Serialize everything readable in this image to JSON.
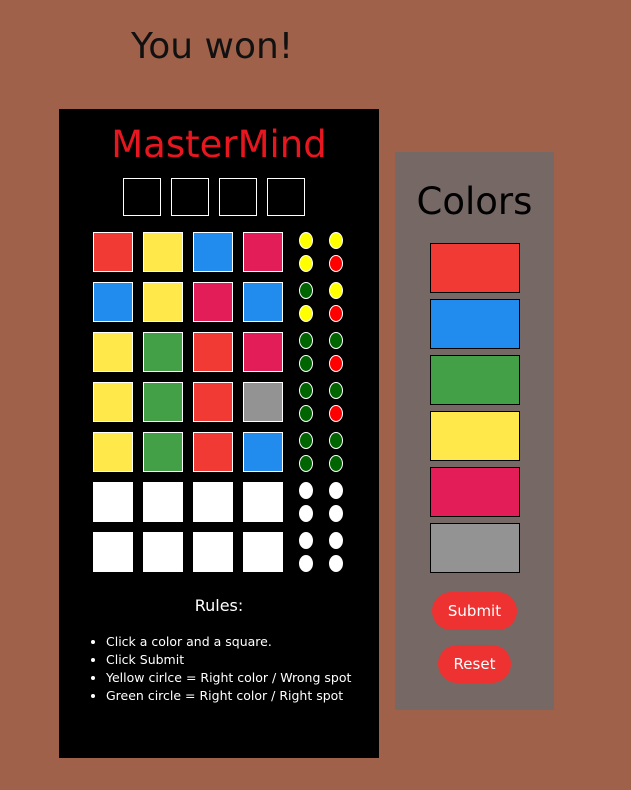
{
  "status_message": "You won!",
  "board": {
    "title": "MasterMind",
    "secret_slots": 4,
    "rows": [
      {
        "squares": [
          "red",
          "yellow",
          "blue",
          "pink"
        ],
        "pegs": [
          "yellow",
          "yellow",
          "yellow",
          "red"
        ]
      },
      {
        "squares": [
          "blue",
          "yellow",
          "pink",
          "blue"
        ],
        "pegs": [
          "green",
          "yellow",
          "yellow",
          "red"
        ]
      },
      {
        "squares": [
          "yellow",
          "green",
          "red",
          "pink"
        ],
        "pegs": [
          "green",
          "green",
          "green",
          "red"
        ]
      },
      {
        "squares": [
          "yellow",
          "green",
          "red",
          "gray"
        ],
        "pegs": [
          "green",
          "green",
          "green",
          "red"
        ]
      },
      {
        "squares": [
          "yellow",
          "green",
          "red",
          "blue"
        ],
        "pegs": [
          "green",
          "green",
          "green",
          "green"
        ]
      },
      {
        "squares": [
          "empty",
          "empty",
          "empty",
          "empty"
        ],
        "pegs": [
          "empty",
          "empty",
          "empty",
          "empty"
        ]
      },
      {
        "squares": [
          "empty",
          "empty",
          "empty",
          "empty"
        ],
        "pegs": [
          "empty",
          "empty",
          "empty",
          "empty"
        ]
      }
    ],
    "rules_title": "Rules:",
    "rules": [
      "Click a color and a square.",
      "Click Submit",
      "Yellow cirlce = Right color / Wrong spot",
      "Green circle = Right color / Right spot"
    ]
  },
  "palette": {
    "title": "Colors",
    "colors": [
      "red",
      "blue",
      "green",
      "yellow",
      "pink",
      "gray"
    ],
    "submit_label": "Submit",
    "reset_label": "Reset"
  },
  "color_map": {
    "red": "#f23a35",
    "yellow": "#fee84a",
    "blue": "#218ced",
    "pink": "#e21d57",
    "green": "#43a047",
    "gray": "#939393",
    "empty": "#ffffff"
  },
  "peg_color_map": {
    "yellow": "#ffff00",
    "red": "#ff0000",
    "green": "#006400",
    "empty": "#ffffff"
  }
}
